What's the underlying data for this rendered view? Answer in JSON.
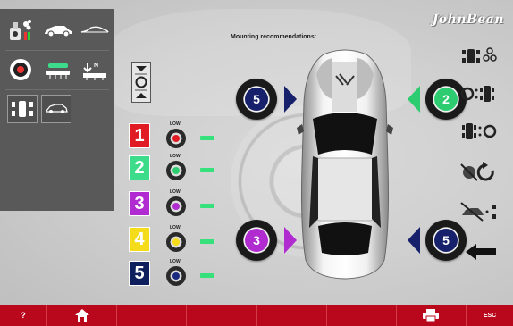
{
  "brand": "JohnBean",
  "header": {
    "recommendation_title": "Mounting recommendations:"
  },
  "sensor_rows": [
    {
      "number": "1",
      "badge_color": "#e01b24",
      "dot_color": "#e01b24",
      "low_label": "LOW"
    },
    {
      "number": "2",
      "badge_color": "#3ddc8a",
      "dot_color": "#2ecc71",
      "low_label": "LOW"
    },
    {
      "number": "3",
      "badge_color": "#b02bd0",
      "dot_color": "#b02bd0",
      "low_label": "LOW"
    },
    {
      "number": "4",
      "badge_color": "#f5dc1a",
      "dot_color": "#f5dc1a",
      "low_label": "LOW"
    },
    {
      "number": "5",
      "badge_color": "#0f1f5e",
      "dot_color": "#1a2a80",
      "low_label": "LOW"
    }
  ],
  "tyres": {
    "front_left": {
      "number": "5",
      "color": "#17206a",
      "arrow_color": "#17206a"
    },
    "front_right": {
      "number": "2",
      "color": "#2ecc71",
      "arrow_color": "#2ecc71"
    },
    "rear_left": {
      "number": "3",
      "color": "#b02bd0",
      "arrow_color": "#b02bd0"
    },
    "rear_right": {
      "number": "5",
      "color": "#17206a",
      "arrow_color": "#17206a"
    }
  },
  "bottom_bar": {
    "help_label": "?",
    "esc_label": "ESC"
  },
  "colors": {
    "panel": "#595959",
    "function_bar": "#b9071c",
    "dash": "#36e07a"
  }
}
